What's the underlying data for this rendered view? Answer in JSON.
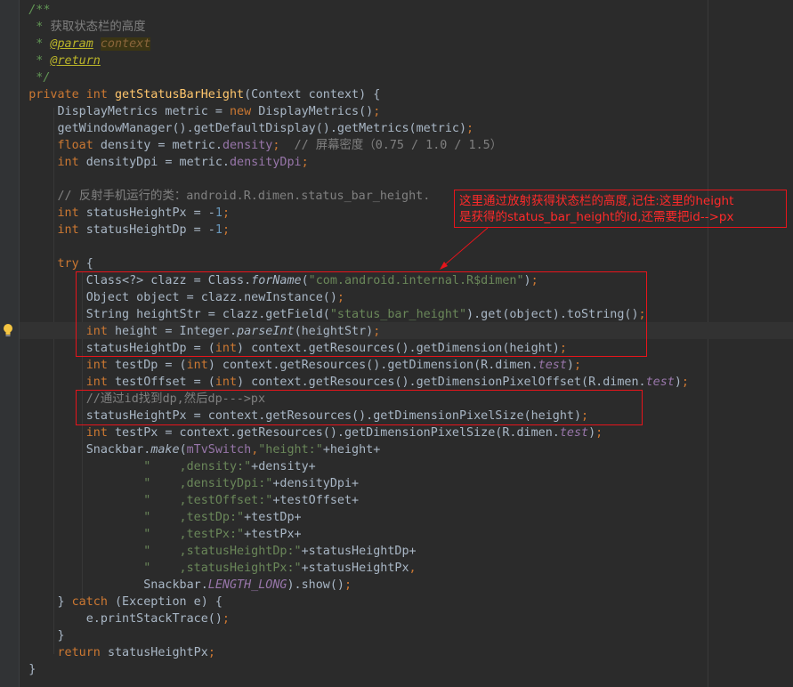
{
  "code": {
    "lines": [
      [
        {
          "t": "    /**",
          "c": "c"
        }
      ],
      [
        {
          "t": "     * ",
          "c": "c"
        },
        {
          "t": "获取状态栏的高度",
          "c": "cz"
        }
      ],
      [
        {
          "t": "     * ",
          "c": "c"
        },
        {
          "t": "@param",
          "c": "at"
        },
        {
          "t": " ",
          "c": "c"
        },
        {
          "t": "context",
          "c": "pv"
        }
      ],
      [
        {
          "t": "     * ",
          "c": "c"
        },
        {
          "t": "@return",
          "c": "at"
        }
      ],
      [
        {
          "t": "     */",
          "c": "c"
        }
      ],
      [
        {
          "t": "    private int ",
          "c": "k"
        },
        {
          "t": "getStatusBarHeight",
          "c": "fn"
        },
        {
          "t": "(Context context) {",
          "c": ""
        }
      ],
      [
        {
          "t": "        DisplayMetrics metric = ",
          "c": ""
        },
        {
          "t": "new ",
          "c": "k"
        },
        {
          "t": "DisplayMetrics()",
          "c": ""
        },
        {
          "t": ";",
          "c": "k"
        }
      ],
      [
        {
          "t": "        getWindowManager().getDefaultDisplay().getMetrics(metric)",
          "c": ""
        },
        {
          "t": ";",
          "c": "k"
        }
      ],
      [
        {
          "t": "        float ",
          "c": "k"
        },
        {
          "t": "density = metric.",
          "c": ""
        },
        {
          "t": "density",
          "c": "f"
        },
        {
          "t": ";  ",
          "c": "k"
        },
        {
          "t": "// ",
          "c": "lc"
        },
        {
          "t": "屏幕密度",
          "c": "cz"
        },
        {
          "t": "（0.75 / 1.0 / 1.5）",
          "c": "lc"
        }
      ],
      [
        {
          "t": "        int ",
          "c": "k"
        },
        {
          "t": "densityDpi = metric.",
          "c": ""
        },
        {
          "t": "densityDpi",
          "c": "f"
        },
        {
          "t": ";",
          "c": "k"
        }
      ],
      [],
      [
        {
          "t": "        // ",
          "c": "lc"
        },
        {
          "t": "反射手机运行的类",
          "c": "cz"
        },
        {
          "t": "：android.R.dimen.status_bar_height.",
          "c": "lc"
        }
      ],
      [
        {
          "t": "        int ",
          "c": "k"
        },
        {
          "t": "statusHeightPx = -",
          "c": ""
        },
        {
          "t": "1",
          "c": "n"
        },
        {
          "t": ";",
          "c": "k"
        }
      ],
      [
        {
          "t": "        int ",
          "c": "k"
        },
        {
          "t": "statusHeightDp = -",
          "c": ""
        },
        {
          "t": "1",
          "c": "n"
        },
        {
          "t": ";",
          "c": "k"
        }
      ],
      [],
      [
        {
          "t": "        try ",
          "c": "k"
        },
        {
          "t": "{",
          "c": ""
        }
      ],
      [
        {
          "t": "            Class<?> clazz = Class.",
          "c": ""
        },
        {
          "t": "forName",
          "c": "i"
        },
        {
          "t": "(",
          "c": ""
        },
        {
          "t": "\"com.android.internal.R$dimen\"",
          "c": "s"
        },
        {
          "t": ")",
          "c": ""
        },
        {
          "t": ";",
          "c": "k"
        }
      ],
      [
        {
          "t": "            Object object = clazz.newInstance()",
          "c": ""
        },
        {
          "t": ";",
          "c": "k"
        }
      ],
      [
        {
          "t": "            String heightStr = clazz.getField(",
          "c": ""
        },
        {
          "t": "\"status_bar_height\"",
          "c": "s"
        },
        {
          "t": ").get(object).toString()",
          "c": ""
        },
        {
          "t": ";",
          "c": "k"
        }
      ],
      [
        {
          "t": "            int ",
          "c": "k"
        },
        {
          "t": "height = Integer.",
          "c": ""
        },
        {
          "t": "parseInt",
          "c": "i"
        },
        {
          "t": "(heightStr)",
          "c": ""
        },
        {
          "t": ";",
          "c": "k"
        }
      ],
      [
        {
          "t": "            statusHeightDp = (",
          "c": ""
        },
        {
          "t": "int",
          "c": "k"
        },
        {
          "t": ") context.getResources().getDimension(height)",
          "c": ""
        },
        {
          "t": ";",
          "c": "k"
        }
      ],
      [
        {
          "t": "            int ",
          "c": "k"
        },
        {
          "t": "testDp = (",
          "c": ""
        },
        {
          "t": "int",
          "c": "k"
        },
        {
          "t": ") context.getResources().getDimension(R.dimen.",
          "c": ""
        },
        {
          "t": "test",
          "c": "fi"
        },
        {
          "t": ")",
          "c": ""
        },
        {
          "t": ";",
          "c": "k"
        }
      ],
      [
        {
          "t": "            int ",
          "c": "k"
        },
        {
          "t": "testOffset = (",
          "c": ""
        },
        {
          "t": "int",
          "c": "k"
        },
        {
          "t": ") context.getResources().getDimensionPixelOffset(R.dimen.",
          "c": ""
        },
        {
          "t": "test",
          "c": "fi"
        },
        {
          "t": ")",
          "c": ""
        },
        {
          "t": ";",
          "c": "k"
        }
      ],
      [
        {
          "t": "            //",
          "c": "lc"
        },
        {
          "t": "通过",
          "c": "cz"
        },
        {
          "t": "id",
          "c": "lc"
        },
        {
          "t": "找到",
          "c": "cz"
        },
        {
          "t": "dp,",
          "c": "lc"
        },
        {
          "t": "然后",
          "c": "cz"
        },
        {
          "t": "dp--->px",
          "c": "lc"
        }
      ],
      [
        {
          "t": "            statusHeightPx = context.getResources().getDimensionPixelSize(height)",
          "c": ""
        },
        {
          "t": ";",
          "c": "k"
        }
      ],
      [
        {
          "t": "            int ",
          "c": "k"
        },
        {
          "t": "testPx = context.getResources().getDimensionPixelSize(R.dimen.",
          "c": ""
        },
        {
          "t": "test",
          "c": "fi"
        },
        {
          "t": ")",
          "c": ""
        },
        {
          "t": ";",
          "c": "k"
        }
      ],
      [
        {
          "t": "            Snackbar.",
          "c": ""
        },
        {
          "t": "make",
          "c": "i"
        },
        {
          "t": "(",
          "c": ""
        },
        {
          "t": "mTvSwitch",
          "c": "f"
        },
        {
          "t": ",",
          "c": "k"
        },
        {
          "t": "\"height:\"",
          "c": "s"
        },
        {
          "t": "+height+",
          "c": ""
        }
      ],
      [
        {
          "t": "                    \"    ,density:\"",
          "c": "s"
        },
        {
          "t": "+density+",
          "c": ""
        }
      ],
      [
        {
          "t": "                    \"    ,densityDpi:\"",
          "c": "s"
        },
        {
          "t": "+densityDpi+",
          "c": ""
        }
      ],
      [
        {
          "t": "                    \"    ,testOffset:\"",
          "c": "s"
        },
        {
          "t": "+testOffset+",
          "c": ""
        }
      ],
      [
        {
          "t": "                    \"    ,testDp:\"",
          "c": "s"
        },
        {
          "t": "+testDp+",
          "c": ""
        }
      ],
      [
        {
          "t": "                    \"    ,testPx:\"",
          "c": "s"
        },
        {
          "t": "+testPx+",
          "c": ""
        }
      ],
      [
        {
          "t": "                    \"    ,statusHeightDp:\"",
          "c": "s"
        },
        {
          "t": "+statusHeightDp+",
          "c": ""
        }
      ],
      [
        {
          "t": "                    \"    ,statusHeightPx:\"",
          "c": "s"
        },
        {
          "t": "+statusHeightPx",
          "c": ""
        },
        {
          "t": ",",
          "c": "k"
        }
      ],
      [
        {
          "t": "                    Snackbar.",
          "c": ""
        },
        {
          "t": "LENGTH_LONG",
          "c": "fi"
        },
        {
          "t": ").show()",
          "c": ""
        },
        {
          "t": ";",
          "c": "k"
        }
      ],
      [
        {
          "t": "        ",
          "c": ""
        },
        {
          "t": "} ",
          "c": ""
        },
        {
          "t": "catch ",
          "c": "k"
        },
        {
          "t": "(Exception e) {",
          "c": ""
        }
      ],
      [
        {
          "t": "            e.printStackTrace()",
          "c": ""
        },
        {
          "t": ";",
          "c": "k"
        }
      ],
      [
        {
          "t": "        }",
          "c": ""
        }
      ],
      [
        {
          "t": "        return ",
          "c": "k"
        },
        {
          "t": "statusHeightPx",
          "c": ""
        },
        {
          "t": ";",
          "c": "k"
        }
      ],
      [
        {
          "t": "    }",
          "c": ""
        }
      ]
    ]
  },
  "annotation": {
    "line1": "这里通过放射获得状态栏的高度,记住:这里的height",
    "line2": "是获得的status_bar_height的id,还需要把id-->px"
  },
  "colors": {
    "background": "#2b2b2b",
    "annotation_red": "#e8141b"
  },
  "icons": [
    "intention-bulb-icon"
  ]
}
